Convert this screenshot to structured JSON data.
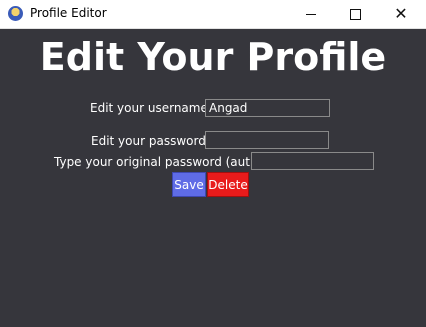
{
  "window": {
    "title": "Profile Editor",
    "controls": {
      "minimize_icon": "minimize-icon",
      "maximize_icon": "maximize-icon",
      "close_icon": "close-icon",
      "close_glyph": "✕"
    }
  },
  "form": {
    "heading": "Edit Your Profile",
    "username_label": "Edit your username -",
    "username_value": "Angad",
    "password_label": "Edit your password -",
    "password_value": "",
    "auth_label": "Type your original password (auth) -",
    "auth_value": "",
    "save_label": "Save",
    "delete_label": "Delete"
  },
  "colors": {
    "background": "#36363c",
    "save": "#5f6ce6",
    "delete": "#e81b1b",
    "text": "#ffffff"
  }
}
